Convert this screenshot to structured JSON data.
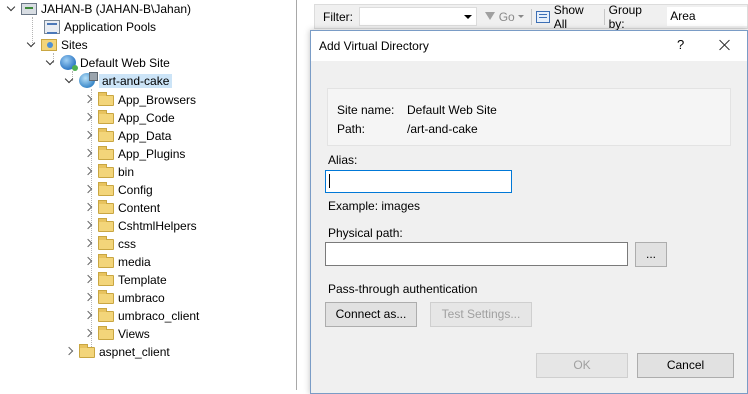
{
  "tree": {
    "items": [
      {
        "label": "JAHAN-B (JAHAN-B\\Jahan)",
        "icon": "server-icon"
      },
      {
        "label": "Application Pools",
        "icon": "app-pools-icon"
      },
      {
        "label": "Sites",
        "icon": "sites-folder-icon"
      },
      {
        "label": "Default Web Site",
        "icon": "website-globe-icon"
      },
      {
        "label": "art-and-cake",
        "icon": "application-icon"
      },
      {
        "label": "App_Browsers",
        "icon": "folder-icon"
      },
      {
        "label": "App_Code",
        "icon": "folder-icon"
      },
      {
        "label": "App_Data",
        "icon": "folder-icon"
      },
      {
        "label": "App_Plugins",
        "icon": "folder-icon"
      },
      {
        "label": "bin",
        "icon": "folder-icon"
      },
      {
        "label": "Config",
        "icon": "folder-icon"
      },
      {
        "label": "Content",
        "icon": "folder-icon"
      },
      {
        "label": "CshtmlHelpers",
        "icon": "folder-icon"
      },
      {
        "label": "css",
        "icon": "folder-icon"
      },
      {
        "label": "media",
        "icon": "folder-icon"
      },
      {
        "label": "Template",
        "icon": "folder-icon"
      },
      {
        "label": "umbraco",
        "icon": "folder-icon"
      },
      {
        "label": "umbraco_client",
        "icon": "folder-icon"
      },
      {
        "label": "Views",
        "icon": "folder-icon"
      },
      {
        "label": "aspnet_client",
        "icon": "folder-icon"
      }
    ]
  },
  "toolbar": {
    "filter_label": "Filter:",
    "go_label": "Go",
    "show_all_label": "Show All",
    "group_by_label": "Group by:",
    "group_by_value": "Area"
  },
  "dialog": {
    "title": "Add Virtual Directory",
    "help": "?",
    "site_name_label": "Site name:",
    "site_name_value": "Default Web Site",
    "path_label": "Path:",
    "path_value": "/art-and-cake",
    "alias_label": "Alias:",
    "alias_value": "",
    "example_text": "Example: images",
    "physical_path_label": "Physical path:",
    "physical_path_value": "",
    "browse_label": "...",
    "pass_through_label": "Pass-through authentication",
    "connect_as_label": "Connect as...",
    "test_settings_label": "Test Settings...",
    "ok_label": "OK",
    "cancel_label": "Cancel"
  },
  "colors": {
    "selection": "#cce4f7",
    "dialog_border": "#7a9cc6",
    "focus_border": "#0078d7"
  }
}
